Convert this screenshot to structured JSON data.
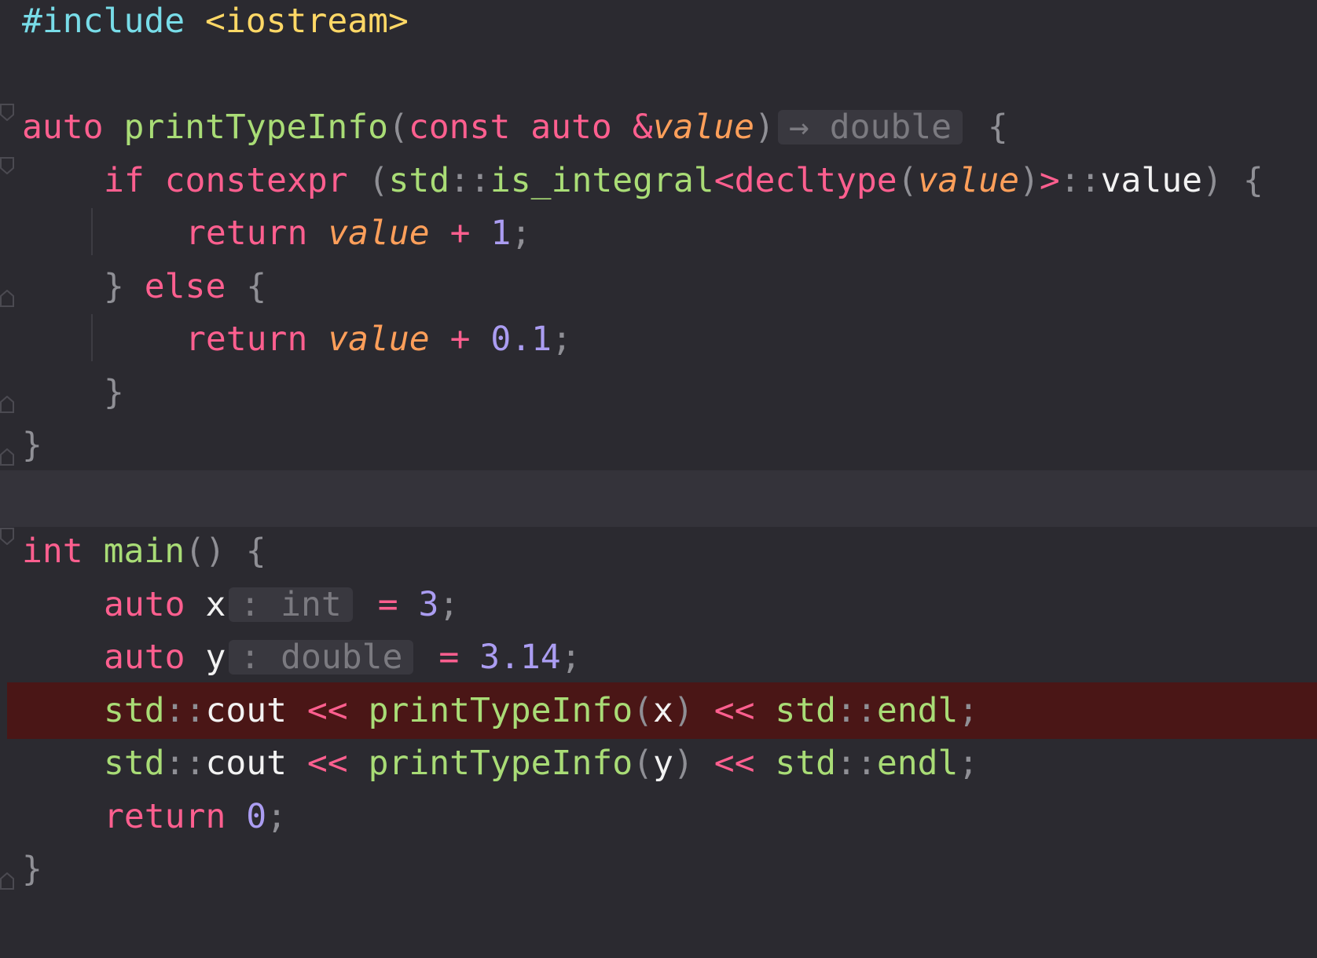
{
  "editor": {
    "lines": [
      {
        "tokens": [
          {
            "t": "#include",
            "c": "pre"
          },
          {
            "t": " ",
            "c": "ws"
          },
          {
            "t": "<iostream>",
            "c": "inc"
          }
        ]
      },
      {
        "tokens": []
      },
      {
        "tokens": [
          {
            "t": "auto",
            "c": "kw"
          },
          {
            "t": " ",
            "c": "ws"
          },
          {
            "t": "printTypeInfo",
            "c": "fn"
          },
          {
            "t": "(",
            "c": "pun"
          },
          {
            "t": "const",
            "c": "kw"
          },
          {
            "t": " ",
            "c": "ws"
          },
          {
            "t": "auto",
            "c": "kw"
          },
          {
            "t": " ",
            "c": "ws"
          },
          {
            "t": "&",
            "c": "op"
          },
          {
            "t": "value",
            "c": "par"
          },
          {
            "t": ")",
            "c": "pun"
          },
          {
            "hint": "→ double"
          },
          {
            "t": " ",
            "c": "ws"
          },
          {
            "t": "{",
            "c": "pun"
          }
        ]
      },
      {
        "indent": 1,
        "tokens": [
          {
            "t": "if",
            "c": "kw"
          },
          {
            "t": " ",
            "c": "ws"
          },
          {
            "t": "constexpr",
            "c": "kw"
          },
          {
            "t": " ",
            "c": "ws"
          },
          {
            "t": "(",
            "c": "pun"
          },
          {
            "t": "std",
            "c": "ns"
          },
          {
            "t": "::",
            "c": "pun"
          },
          {
            "t": "is_integral",
            "c": "ns"
          },
          {
            "t": "<",
            "c": "op"
          },
          {
            "t": "decltype",
            "c": "kw"
          },
          {
            "t": "(",
            "c": "pun"
          },
          {
            "t": "value",
            "c": "par"
          },
          {
            "t": ")",
            "c": "pun"
          },
          {
            "t": ">",
            "c": "op"
          },
          {
            "t": "::",
            "c": "pun"
          },
          {
            "t": "value",
            "c": "var"
          },
          {
            "t": ")",
            "c": "pun"
          },
          {
            "t": " ",
            "c": "ws"
          },
          {
            "t": "{",
            "c": "pun"
          }
        ]
      },
      {
        "indent": 2,
        "tokens": [
          {
            "t": "return",
            "c": "kw"
          },
          {
            "t": " ",
            "c": "ws"
          },
          {
            "t": "value",
            "c": "par"
          },
          {
            "t": " ",
            "c": "ws"
          },
          {
            "t": "+",
            "c": "op"
          },
          {
            "t": " ",
            "c": "ws"
          },
          {
            "t": "1",
            "c": "num"
          },
          {
            "t": ";",
            "c": "pun"
          }
        ]
      },
      {
        "indent": 1,
        "tokens": [
          {
            "t": "}",
            "c": "pun"
          },
          {
            "t": " ",
            "c": "ws"
          },
          {
            "t": "else",
            "c": "kw"
          },
          {
            "t": " ",
            "c": "ws"
          },
          {
            "t": "{",
            "c": "pun"
          }
        ]
      },
      {
        "indent": 2,
        "tokens": [
          {
            "t": "return",
            "c": "kw"
          },
          {
            "t": " ",
            "c": "ws"
          },
          {
            "t": "value",
            "c": "par"
          },
          {
            "t": " ",
            "c": "ws"
          },
          {
            "t": "+",
            "c": "op"
          },
          {
            "t": " ",
            "c": "ws"
          },
          {
            "t": "0.1",
            "c": "num"
          },
          {
            "t": ";",
            "c": "pun"
          }
        ]
      },
      {
        "indent": 1,
        "tokens": [
          {
            "t": "}",
            "c": "pun"
          }
        ]
      },
      {
        "tokens": [
          {
            "t": "}",
            "c": "pun"
          }
        ]
      },
      {
        "caret": true,
        "tokens": []
      },
      {
        "tokens": [
          {
            "t": "int",
            "c": "ty"
          },
          {
            "t": " ",
            "c": "ws"
          },
          {
            "t": "main",
            "c": "fn"
          },
          {
            "t": "()",
            "c": "pun"
          },
          {
            "t": " ",
            "c": "ws"
          },
          {
            "t": "{",
            "c": "pun"
          }
        ]
      },
      {
        "indent": 1,
        "tokens": [
          {
            "t": "auto",
            "c": "kw"
          },
          {
            "t": " ",
            "c": "ws"
          },
          {
            "t": "x",
            "c": "var"
          },
          {
            "hint": ": int"
          },
          {
            "t": " ",
            "c": "ws"
          },
          {
            "t": "=",
            "c": "op"
          },
          {
            "t": " ",
            "c": "ws"
          },
          {
            "t": "3",
            "c": "num"
          },
          {
            "t": ";",
            "c": "pun"
          }
        ]
      },
      {
        "indent": 1,
        "tokens": [
          {
            "t": "auto",
            "c": "kw"
          },
          {
            "t": " ",
            "c": "ws"
          },
          {
            "t": "y",
            "c": "var"
          },
          {
            "hint": ": double"
          },
          {
            "t": " ",
            "c": "ws"
          },
          {
            "t": "=",
            "c": "op"
          },
          {
            "t": " ",
            "c": "ws"
          },
          {
            "t": "3.14",
            "c": "num"
          },
          {
            "t": ";",
            "c": "pun"
          }
        ]
      },
      {
        "indent": 1,
        "error": true,
        "tokens": [
          {
            "t": "std",
            "c": "ns"
          },
          {
            "t": "::",
            "c": "pun"
          },
          {
            "t": "cout",
            "c": "var"
          },
          {
            "t": " ",
            "c": "ws"
          },
          {
            "t": "<<",
            "c": "op"
          },
          {
            "t": " ",
            "c": "ws"
          },
          {
            "t": "printTypeInfo",
            "c": "fn"
          },
          {
            "t": "(",
            "c": "pun"
          },
          {
            "t": "x",
            "c": "var"
          },
          {
            "t": ")",
            "c": "pun"
          },
          {
            "t": " ",
            "c": "ws"
          },
          {
            "t": "<<",
            "c": "op"
          },
          {
            "t": " ",
            "c": "ws"
          },
          {
            "t": "std",
            "c": "ns"
          },
          {
            "t": "::",
            "c": "pun"
          },
          {
            "t": "endl",
            "c": "ns"
          },
          {
            "t": ";",
            "c": "pun"
          }
        ]
      },
      {
        "indent": 1,
        "tokens": [
          {
            "t": "std",
            "c": "ns"
          },
          {
            "t": "::",
            "c": "pun"
          },
          {
            "t": "cout",
            "c": "var"
          },
          {
            "t": " ",
            "c": "ws"
          },
          {
            "t": "<<",
            "c": "op"
          },
          {
            "t": " ",
            "c": "ws"
          },
          {
            "t": "printTypeInfo",
            "c": "fn"
          },
          {
            "t": "(",
            "c": "pun"
          },
          {
            "t": "y",
            "c": "var"
          },
          {
            "t": ")",
            "c": "pun"
          },
          {
            "t": " ",
            "c": "ws"
          },
          {
            "t": "<<",
            "c": "op"
          },
          {
            "t": " ",
            "c": "ws"
          },
          {
            "t": "std",
            "c": "ns"
          },
          {
            "t": "::",
            "c": "pun"
          },
          {
            "t": "endl",
            "c": "ns"
          },
          {
            "t": ";",
            "c": "pun"
          }
        ]
      },
      {
        "indent": 1,
        "tokens": [
          {
            "t": "return",
            "c": "kw"
          },
          {
            "t": " ",
            "c": "ws"
          },
          {
            "t": "0",
            "c": "num"
          },
          {
            "t": ";",
            "c": "pun"
          }
        ]
      },
      {
        "tokens": [
          {
            "t": "}",
            "c": "pun"
          }
        ]
      }
    ]
  },
  "colors": {
    "background": "#2b2a30",
    "caret_line": "#34333a",
    "error_line": "#4a1616",
    "keyword": "#ff5f8f",
    "function": "#a9dc76",
    "parameter": "#ff9f5a",
    "number": "#ab9df2",
    "preprocessor": "#78dce8",
    "include_path": "#ffd866"
  }
}
